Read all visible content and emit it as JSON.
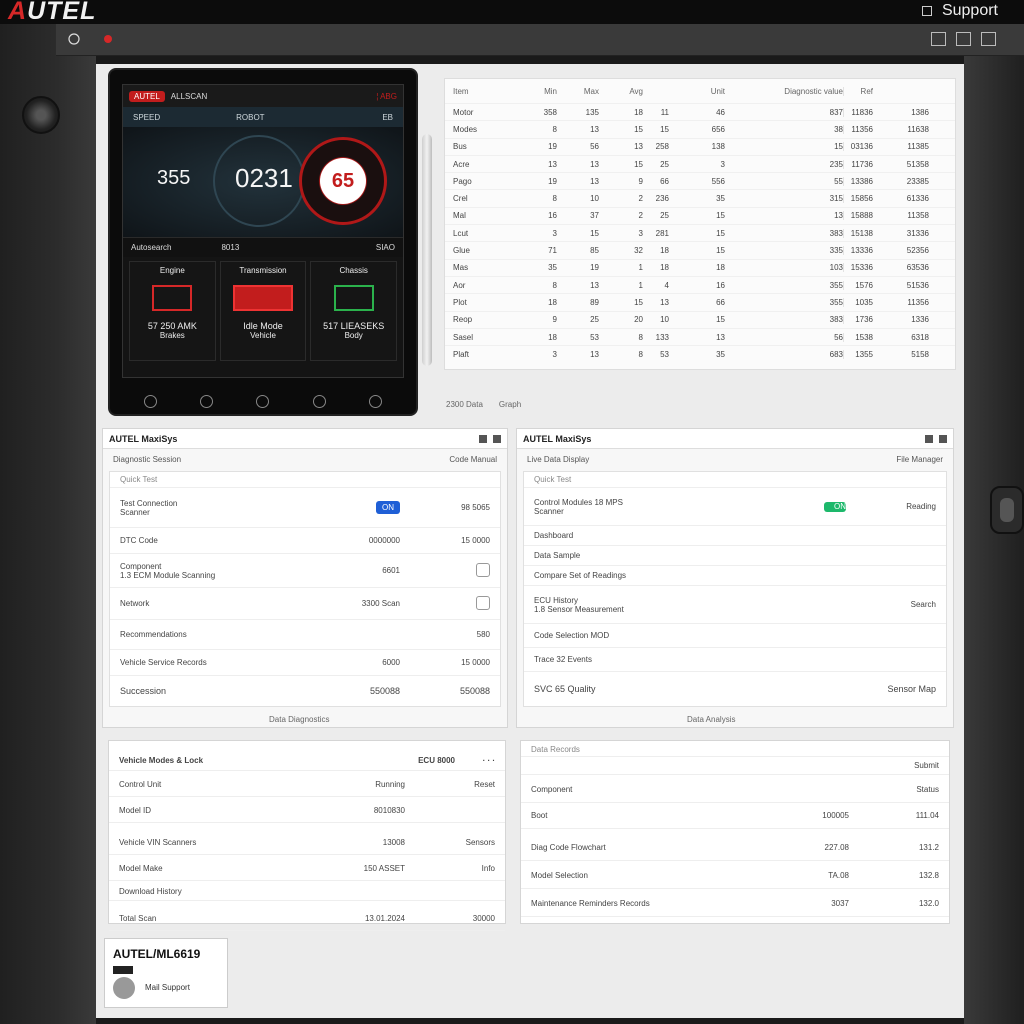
{
  "header": {
    "brand_prefix": "A",
    "brand_rest": "UTEL",
    "support_label": "Support"
  },
  "device": {
    "badge": "AUTEL",
    "head_text": "ALLSCAN",
    "head_right": "¦ ABG",
    "sub_left": "SPEED",
    "sub_mid": "ROBOT",
    "sub_right": "EB",
    "gauge_left": "355",
    "gauge_big": "0231",
    "gauge_red": "65",
    "row_text": "Autosearch",
    "row_mid": "8013",
    "row_right": "SIAO",
    "tiles": [
      {
        "top": "Engine",
        "val": "57 250 AMK",
        "foot": "Brakes"
      },
      {
        "top": "Transmission",
        "val": "Idle Mode",
        "foot": "Vehicle"
      },
      {
        "top": "Chassis",
        "val": "517 LIEASEKS",
        "foot": "Body"
      }
    ]
  },
  "table": {
    "headers": [
      "Item",
      "Min",
      "Max",
      "Avg",
      "",
      "Unit",
      "Diagnostic value",
      "Ref",
      ""
    ],
    "rows": [
      [
        "Motor",
        "358",
        "135",
        "18",
        "11",
        "46",
        "837",
        "11836",
        "1386"
      ],
      [
        "Modes",
        "8",
        "13",
        "15",
        "15",
        "656",
        "38",
        "11356",
        "11638"
      ],
      [
        "Bus",
        "19",
        "56",
        "13",
        "258",
        "138",
        "15",
        "03136",
        "11385"
      ],
      [
        "Acre",
        "13",
        "13",
        "15",
        "25",
        "3",
        "235",
        "11736",
        "51358"
      ],
      [
        "Pago",
        "19",
        "13",
        "9",
        "66",
        "556",
        "55",
        "13386",
        "23385"
      ],
      [
        "Crel",
        "8",
        "10",
        "2",
        "236",
        "35",
        "315",
        "15856",
        "61336"
      ],
      [
        "Mal",
        "16",
        "37",
        "2",
        "25",
        "15",
        "13",
        "15888",
        "11358"
      ],
      [
        "Lcut",
        "3",
        "15",
        "3",
        "281",
        "15",
        "383",
        "15138",
        "31336"
      ],
      [
        "Glue",
        "71",
        "85",
        "32",
        "18",
        "15",
        "335",
        "13336",
        "52356"
      ],
      [
        "Mas",
        "35",
        "19",
        "1",
        "18",
        "18",
        "103",
        "15336",
        "63536"
      ],
      [
        "Aor",
        "8",
        "13",
        "1",
        "4",
        "16",
        "355",
        "1576",
        "51536"
      ],
      [
        "Plot",
        "18",
        "89",
        "15",
        "13",
        "66",
        "355",
        "1035",
        "11356"
      ],
      [
        "Reop",
        "9",
        "25",
        "20",
        "10",
        "15",
        "383",
        "1736",
        "1336"
      ],
      [
        "Sasel",
        "18",
        "53",
        "8",
        "133",
        "13",
        "56",
        "1538",
        "6318"
      ],
      [
        "Plaft",
        "3",
        "13",
        "8",
        "53",
        "35",
        "683",
        "1355",
        "5158"
      ]
    ],
    "caption_left": "2300 Data",
    "caption_right": "Graph"
  },
  "left_card": {
    "title": "AUTEL MaxiSys",
    "sub_left": "Diagnostic Session",
    "sub_right": "Code Manual",
    "filter": "Quick Test",
    "rows": [
      {
        "label": "Test Connection",
        "label2": "Scanner",
        "mid": "",
        "val": "98 5065",
        "chip": "ON"
      },
      {
        "label": "DTC Code",
        "mid": "0000000",
        "val": "15 0000"
      },
      {
        "label": "Component",
        "label2": "1.3 ECM Module Scanning",
        "mid": "6601",
        "val": ""
      },
      {
        "label": "Network",
        "mid": "3300 Scan",
        "val": ""
      },
      {
        "label": "Recommendations",
        "mid": "",
        "val": "580"
      },
      {
        "label": "Vehicle Service Records",
        "mid": "6000",
        "val": "15 0000"
      },
      {
        "label": "Succession",
        "mid": "550088",
        "val": "550088"
      }
    ],
    "caption": "Data Diagnostics"
  },
  "right_card": {
    "title": "AUTEL MaxiSys",
    "sub_left": "Live Data Display",
    "sub_right": "File Manager",
    "filter": "Quick Test",
    "rows": [
      {
        "label": "Control Modules 18 MPS",
        "label2": "Scanner",
        "chip": "ON",
        "val": "Reading"
      },
      {
        "label": "Dashboard",
        "val": ""
      },
      {
        "label": "Data Sample",
        "val": ""
      },
      {
        "label": "Compare Set of Readings",
        "val": ""
      },
      {
        "label": "ECU History",
        "label2": "1.8 Sensor Measurement",
        "val": "Search"
      },
      {
        "label": "Code Selection MOD",
        "val": ""
      },
      {
        "label": "Trace 32 Events",
        "val": ""
      },
      {
        "label": "SVC 65 Quality",
        "val": "Sensor Map"
      }
    ],
    "caption": "Data Analysis"
  },
  "left_bottom": {
    "title": "Vehicle Modes & Lock",
    "title_val": "ECU 8000",
    "rows": [
      {
        "label": "Control Unit",
        "mid": "Running",
        "val": "Reset"
      },
      {
        "label": "Model ID",
        "mid": "8010830",
        "val": ""
      },
      {
        "label": "Vehicle VIN Scanners",
        "mid": "13008",
        "val": "Sensors"
      },
      {
        "label": "Model Make",
        "mid": "150 ASSET",
        "val": "Info"
      },
      {
        "label": "Download History",
        "mid": "",
        "val": ""
      },
      {
        "label": "Total Scan",
        "mid": "13.01.2024",
        "val": "30000"
      }
    ]
  },
  "right_bottom": {
    "title": "Data Records",
    "title_val": "Submit",
    "rows": [
      {
        "label": "Component",
        "mid": "",
        "val": "Status"
      },
      {
        "label": "Boot",
        "mid": "100005",
        "val": "111.04"
      },
      {
        "label": "Diag Code Flowchart",
        "mid": "227.08",
        "val": "131.2"
      },
      {
        "label": "Model Selection",
        "mid": "TA.08",
        "val": "132.8"
      },
      {
        "label": "Maintenance Reminders Records",
        "mid": "3037",
        "val": "132.0"
      }
    ]
  },
  "id_card": {
    "title": "AUTEL/ML6619",
    "subtitle": "Mail Support"
  },
  "colors": {
    "brand_red": "#d62828",
    "gauge_red": "#c21d1d",
    "status_green": "#1db86b",
    "chip_blue": "#1f5fd6"
  }
}
